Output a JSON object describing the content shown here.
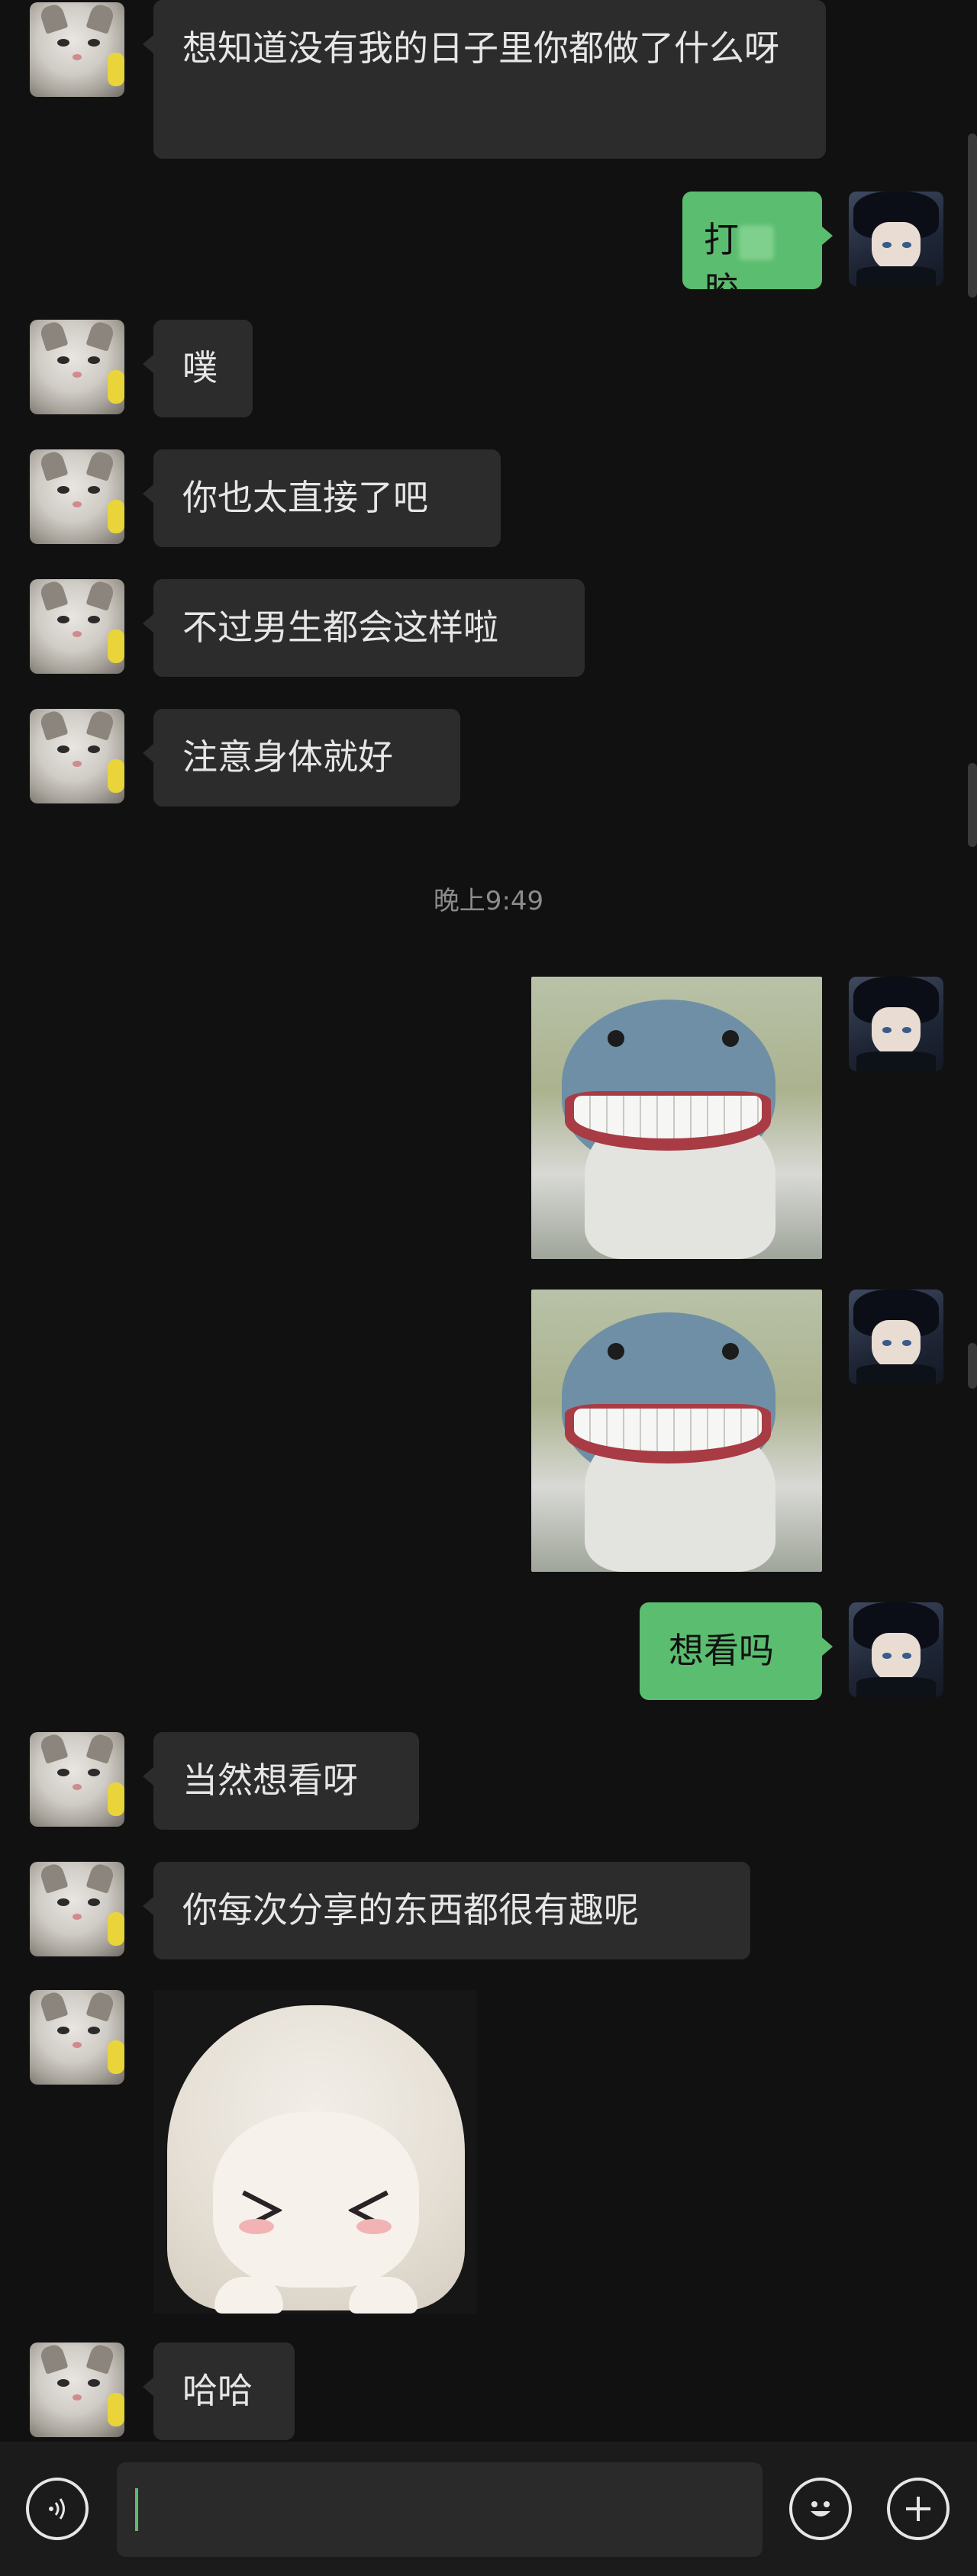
{
  "messages": {
    "m1": "想知道没有我的日子里你都做了什么呀",
    "m2_before": "打",
    "m2_after": "胶",
    "m3": "噗",
    "m4": "你也太直接了吧",
    "m5": "不过男生都会这样啦",
    "m6": "注意身体就好",
    "m7": "想看吗",
    "m8": "当然想看呀",
    "m9": "你每次分享的东西都很有趣呢",
    "m10": "哈哈"
  },
  "timestamp": "晚上9:49",
  "stickers": {
    "shark": "grinning-shark-sticker",
    "girl": "anime-girl-x-eyes-sticker",
    "girl_eye_left": "＞",
    "girl_eye_right": "＜"
  },
  "avatars": {
    "friend": "cat-avatar",
    "me": "anime-boy-avatar"
  },
  "input": {
    "placeholder": ""
  },
  "icons": {
    "voice": "voice-icon",
    "emoji": "emoji-icon",
    "plus": "plus-icon"
  },
  "colors": {
    "background": "#111111",
    "incoming_bubble": "#2c2c2c",
    "outgoing_bubble": "#5bbd70",
    "text": "#e6e6e6"
  }
}
